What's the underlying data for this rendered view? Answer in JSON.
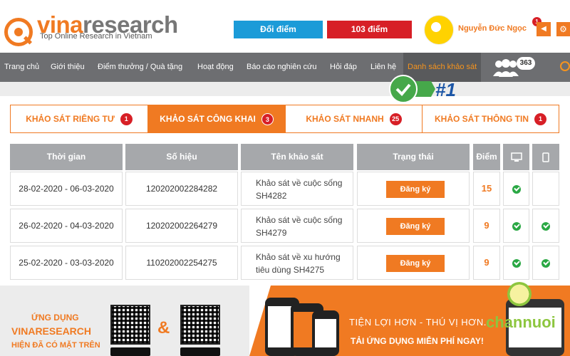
{
  "header": {
    "logo_vina": "vina",
    "logo_research": "research",
    "tagline": "Top Online Research in Vietnam",
    "btn_exchange": "Đổi điểm",
    "btn_points": "103 điểm",
    "user_name": "Nguyễn Đức Ngọc",
    "notif_count": "1"
  },
  "nav": {
    "items": [
      "Trang chủ",
      "Giới thiệu",
      "Điểm thưởng / Quà tặng",
      "Hoạt động",
      "Báo cáo nghiên cứu",
      "Hỏi đáp",
      "Liên hệ",
      "Danh sách khảo sát"
    ],
    "people_count": "363"
  },
  "annotation": {
    "label": "#1"
  },
  "tabs": [
    {
      "label": "KHẢO SÁT RIÊNG TƯ",
      "badge": "1"
    },
    {
      "label": "KHẢO SÁT CÔNG KHAI",
      "badge": "3"
    },
    {
      "label": "KHẢO SÁT NHANH",
      "badge": "25"
    },
    {
      "label": "KHẢO SÁT THÔNG TIN",
      "badge": "1"
    }
  ],
  "table": {
    "headers": [
      "Thời gian",
      "Số hiệu",
      "Tên khảo sát",
      "Trạng thái",
      "Điểm"
    ],
    "rows": [
      {
        "time": "28-02-2020 - 06-03-2020",
        "code": "120202002284282",
        "name1": "Khảo sát về cuộc sống",
        "name2": "SH4282",
        "status": "Đăng ký",
        "points": "15"
      },
      {
        "time": "26-02-2020 - 04-03-2020",
        "code": "120202002264279",
        "name1": "Khảo sát về cuộc sống",
        "name2": "SH4279",
        "status": "Đăng ký",
        "points": "9"
      },
      {
        "time": "25-02-2020 - 03-03-2020",
        "code": "110202002254275",
        "name1": "Khảo sát về xu hướng",
        "name2": "tiêu dùng SH4275",
        "status": "Đăng ký",
        "points": "9"
      }
    ]
  },
  "banner": {
    "line1": "ỨNG DỤNG",
    "line2": "VINARESEARCH",
    "line3": "HIỆN ĐÃ CÓ MẶT TRÊN",
    "amp": "&",
    "slogan": "TIỆN LỢI HƠN - THÚ VỊ HƠN.",
    "slogan2": "TẢI ỨNG DỤNG MIỄN PHÍ NGAY!",
    "watermark": "channuoi"
  },
  "colors": {
    "accent": "#f07a22",
    "nav": "#6d6e71",
    "blue": "#1b9bd8",
    "red": "#d71f26",
    "green": "#2aa844"
  }
}
